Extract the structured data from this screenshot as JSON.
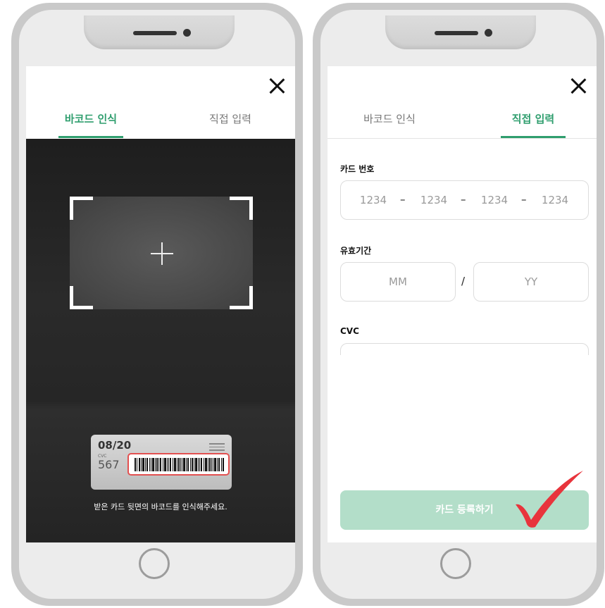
{
  "colors": {
    "accent_green": "#2f9e6e",
    "button_disabled_green": "#b3dec9",
    "highlight_red": "#e25050",
    "checkmark_red": "#e8343c"
  },
  "left_screen": {
    "close_icon": "close-icon",
    "tabs": [
      {
        "label": "바코드 인식",
        "active": true
      },
      {
        "label": "직접 입력",
        "active": false
      }
    ],
    "scanner": {
      "crosshair_icon": "crosshair-icon",
      "sample_card": {
        "expiry": "08/20",
        "cvc_label": "CVC",
        "cvc": "567"
      },
      "hint": "받은 카드 뒷면의 바코드를 인식해주세요."
    }
  },
  "right_screen": {
    "close_icon": "close-icon",
    "tabs": [
      {
        "label": "바코드 인식",
        "active": false
      },
      {
        "label": "직접 입력",
        "active": true
      }
    ],
    "form": {
      "card_number_label": "카드 번호",
      "card_number_placeholders": [
        "1234",
        "1234",
        "1234",
        "1234"
      ],
      "card_number_separator": "–",
      "expiry_label": "유효기간",
      "expiry_month_placeholder": "MM",
      "expiry_separator": "/",
      "expiry_year_placeholder": "YY",
      "cvc_label": "CVC"
    },
    "register_button": "카드 등록하기",
    "annotation_icon": "checkmark-icon"
  }
}
